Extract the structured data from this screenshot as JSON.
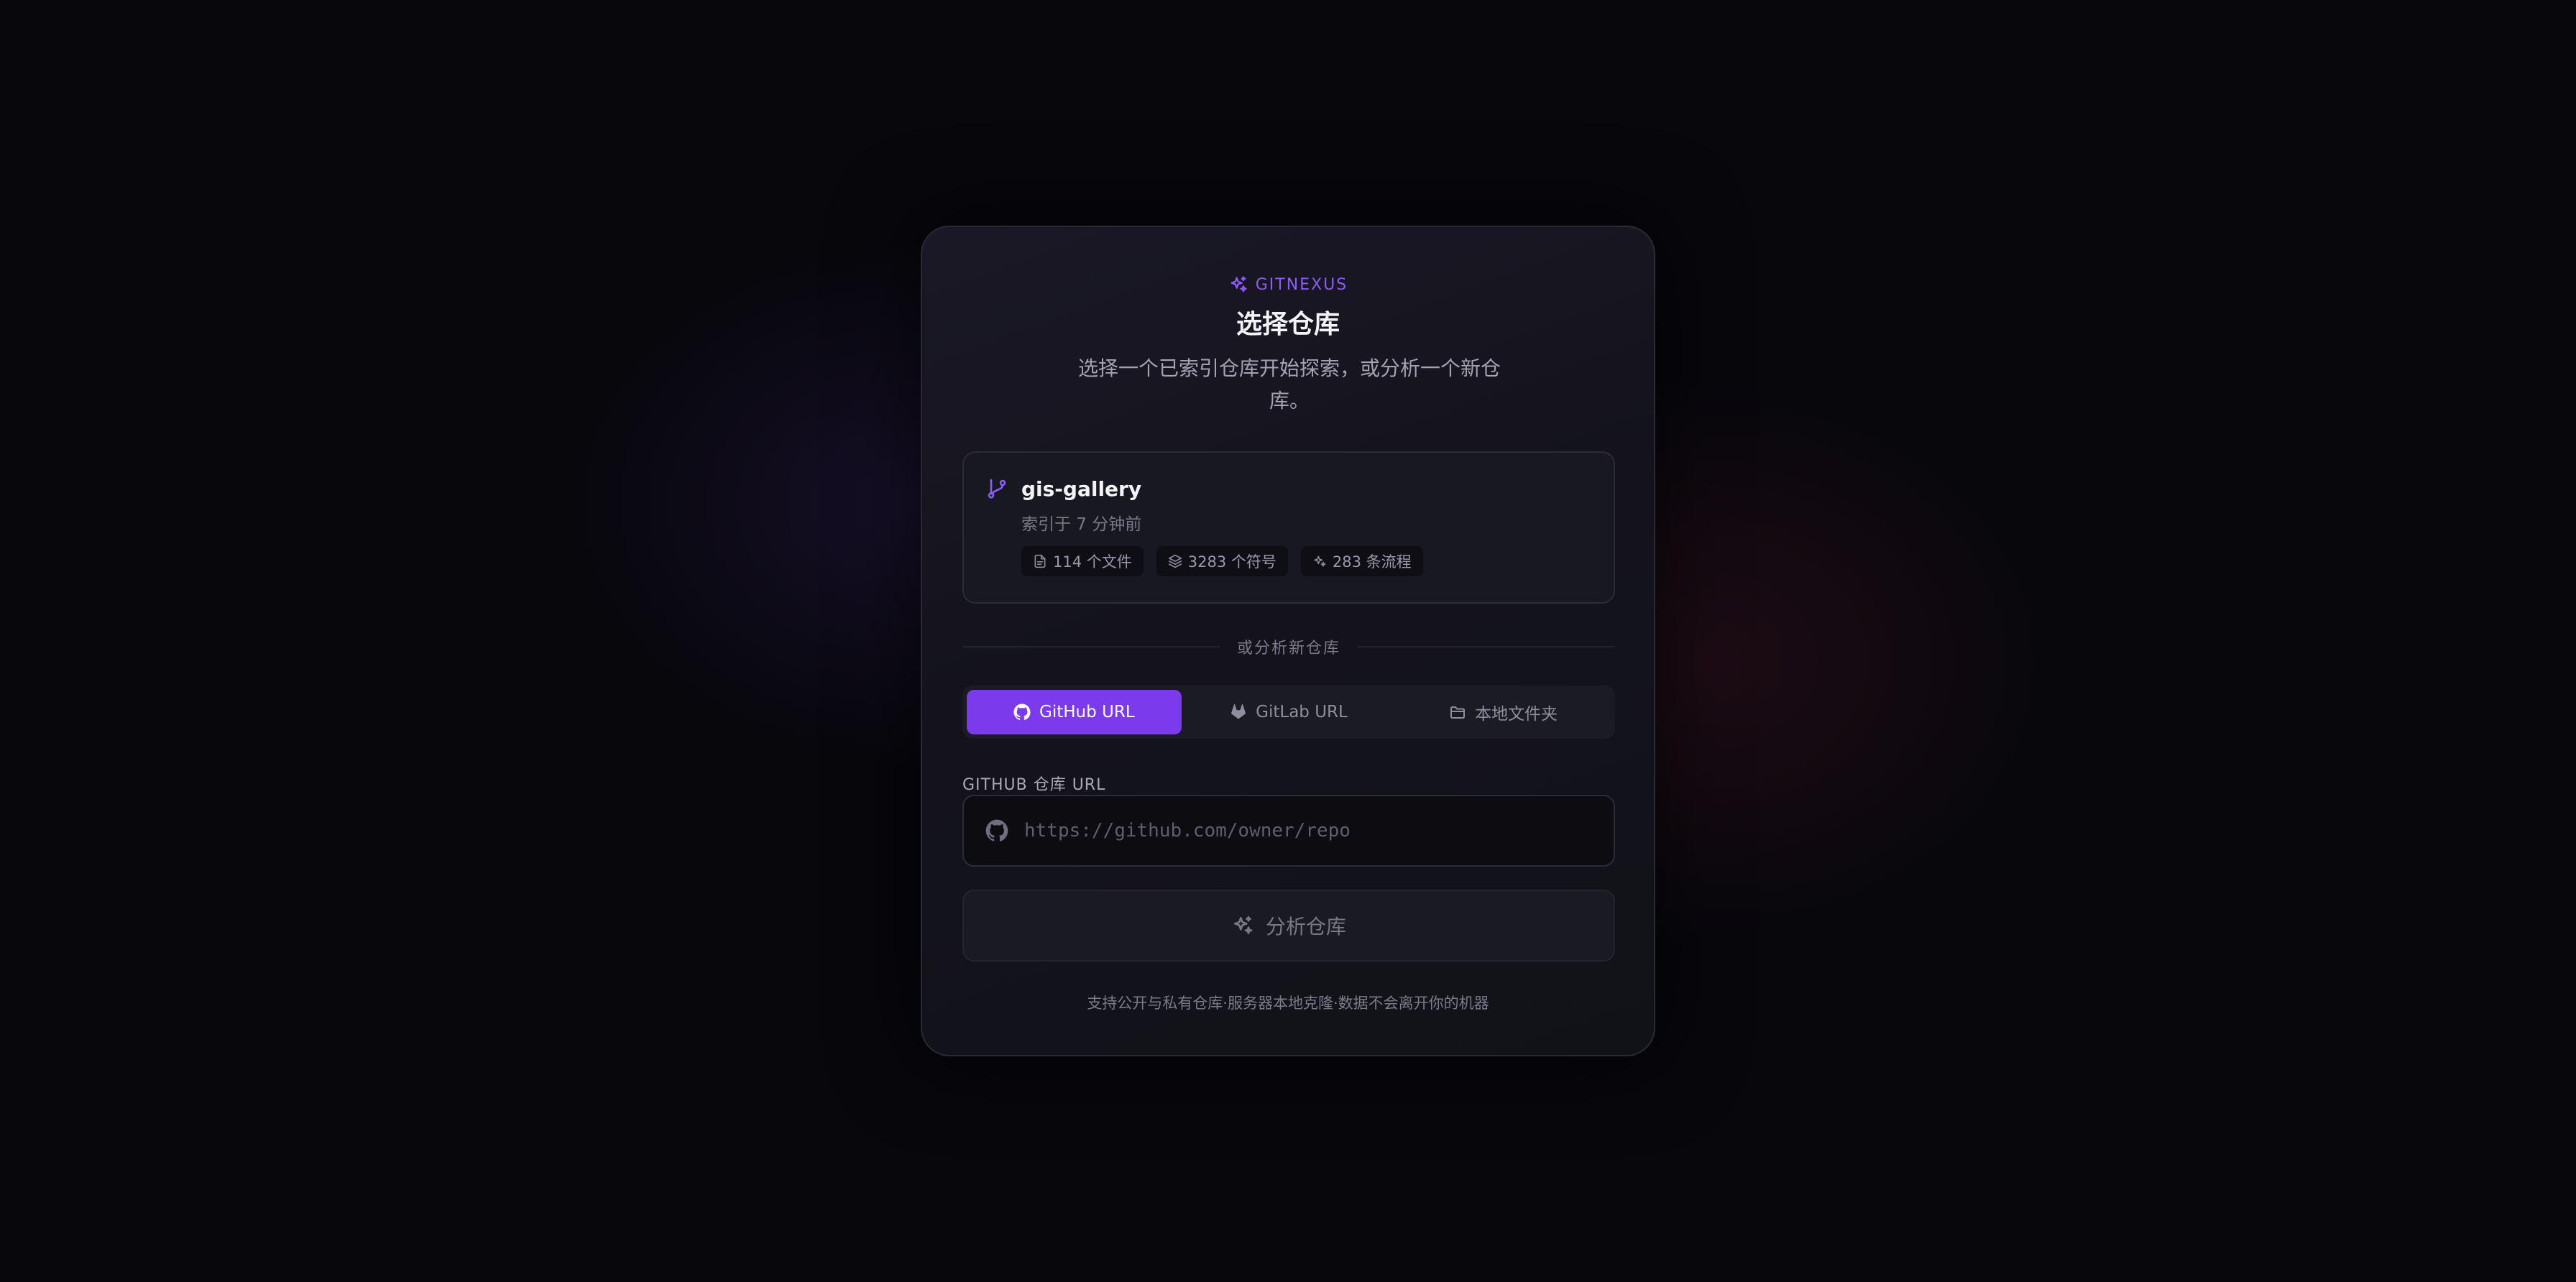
{
  "brand": {
    "name": "GITNEXUS",
    "icon": "sparkles-icon"
  },
  "header": {
    "title": "选择仓库",
    "subtitle": "选择一个已索引仓库开始探索，或分析一个新仓库。"
  },
  "repos": [
    {
      "name": "gis-gallery",
      "icon": "git-branch-icon",
      "indexed": "索引于 7 分钟前",
      "stats": {
        "files": "114 个文件",
        "symbols": "3283 个符号",
        "flows": "283 条流程"
      }
    }
  ],
  "divider": {
    "text": "或分析新仓库"
  },
  "tabs": [
    {
      "label": "GitHub URL",
      "icon": "github-icon",
      "active": true
    },
    {
      "label": "GitLab URL",
      "icon": "gitlab-icon",
      "active": false
    },
    {
      "label": "本地文件夹",
      "icon": "folder-icon",
      "active": false
    }
  ],
  "form": {
    "label": "GITHUB 仓库 URL",
    "placeholder": "https://github.com/owner/repo",
    "value": "",
    "submit_label": "分析仓库"
  },
  "footer": {
    "text": "支持公开与私有仓库·服务器本地克隆·数据不会离开你的机器"
  },
  "colors": {
    "accent": "#7c3aed",
    "brand": "#8b5cf6",
    "background": "#07070c"
  }
}
